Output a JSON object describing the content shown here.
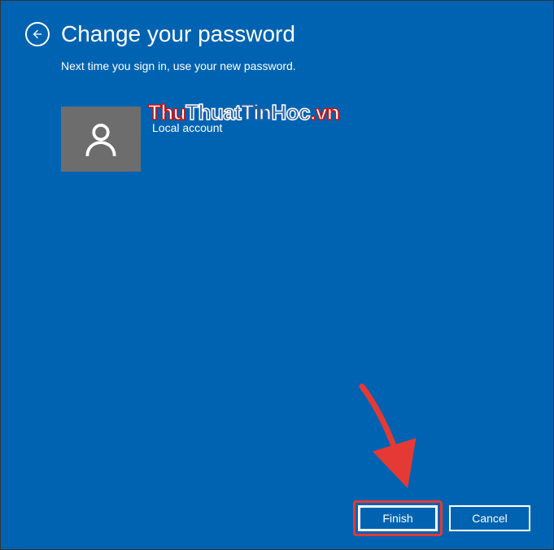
{
  "header": {
    "title": "Change your password",
    "subtitle": "Next time you sign in, use your new password."
  },
  "account": {
    "type_label": "Local account"
  },
  "watermark": {
    "part1": "Thu",
    "part2": "Thuat",
    "part3": "Tin",
    "part4": "Hoc",
    "part5": ".vn"
  },
  "footer": {
    "finish_label": "Finish",
    "cancel_label": "Cancel"
  },
  "colors": {
    "background": "#0063b1",
    "avatar_bg": "#6d6d6d",
    "annotation": "#e53935"
  }
}
